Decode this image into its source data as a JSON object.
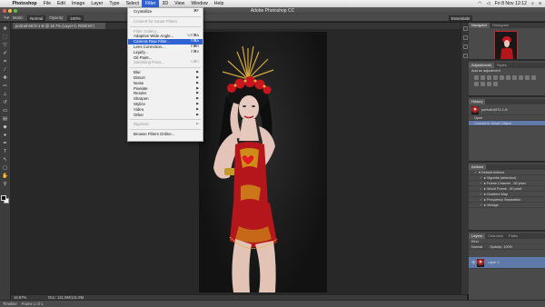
{
  "menubar": {
    "apple": "",
    "items": [
      "Photoshop",
      "File",
      "Edit",
      "Image",
      "Layer",
      "Type",
      "Select",
      "Filter",
      "3D",
      "View",
      "Window",
      "Help"
    ],
    "active_index": 7,
    "clock": "Fri 8 Nov 12:12"
  },
  "app_title": "Adobe Photoshop CC",
  "options": {
    "mode_label": "Mode:",
    "mode_value": "Normal",
    "opacity_label": "Opacity:",
    "opacity_value": "100%",
    "workspace": "Essentials"
  },
  "document": {
    "tab_label": "portrait-6672-1-B @ 16.7% (Layer 0, RGB/16*)",
    "zoom": "16.67%",
    "doc_size": "Doc: 131.9M/131.9M"
  },
  "timeline": {
    "label": "Timeline",
    "frame": "Frame 1 of 1"
  },
  "filter_menu": {
    "items": [
      {
        "label": "Crystallize",
        "shortcut": "⌘F",
        "disabled": false
      },
      {
        "sep": true
      },
      {
        "label": "Convert for Smart Filters",
        "disabled": true
      },
      {
        "sep": true
      },
      {
        "label": "Filter Gallery...",
        "disabled": true
      },
      {
        "label": "Adaptive Wide Angle...",
        "shortcut": "⌥⇧⌘A",
        "disabled": false
      },
      {
        "label": "Camera Raw Filter...",
        "shortcut": "⇧⌘A",
        "highlighted": true
      },
      {
        "label": "Lens Correction...",
        "shortcut": "⇧⌘R",
        "disabled": false
      },
      {
        "label": "Liquify...",
        "shortcut": "⇧⌘X",
        "disabled": false
      },
      {
        "label": "Oil Paint...",
        "disabled": false
      },
      {
        "label": "Vanishing Point...",
        "shortcut": "⌥⌘V",
        "disabled": true
      },
      {
        "sep": true
      },
      {
        "label": "Blur",
        "submenu": true
      },
      {
        "label": "Distort",
        "submenu": true
      },
      {
        "label": "Noise",
        "submenu": true
      },
      {
        "label": "Pixelate",
        "submenu": true
      },
      {
        "label": "Render",
        "submenu": true
      },
      {
        "label": "Sharpen",
        "submenu": true
      },
      {
        "label": "Stylize",
        "submenu": true
      },
      {
        "label": "Video",
        "submenu": true
      },
      {
        "label": "Other",
        "submenu": true
      },
      {
        "sep": true
      },
      {
        "label": "Digimarc",
        "submenu": true,
        "disabled": true
      },
      {
        "sep": true
      },
      {
        "label": "Browse Filters Online..."
      }
    ]
  },
  "panels": {
    "navigator_tabs": [
      "Navigator",
      "Histogram"
    ],
    "adjustments_tabs": [
      "Adjustments",
      "Styles"
    ],
    "adjustments_hint": "Add an adjustment",
    "history_tab": "History",
    "history_items": [
      "portrait-6672-1-B",
      "Open",
      "Convert to Smart Object"
    ],
    "actions_tab": "Actions",
    "actions_items": [
      "Default Actions",
      "Vignette (selection)",
      "Frame Channel - 50 pixel",
      "Wood Frame - 50 pixel",
      "Gradient Map",
      "Frequency Separation",
      "Vintage"
    ],
    "layers_tabs": [
      "Layers",
      "Channels",
      "Paths"
    ],
    "layers_kind": "Kind",
    "layers_mode": "Normal",
    "layers_opacity": "Opacity: 100%",
    "layer_name": "Layer 0"
  },
  "colors": {
    "menu_highlight": "#2f63d3",
    "dress_red": "#b5161c",
    "gold": "#d4a017"
  }
}
